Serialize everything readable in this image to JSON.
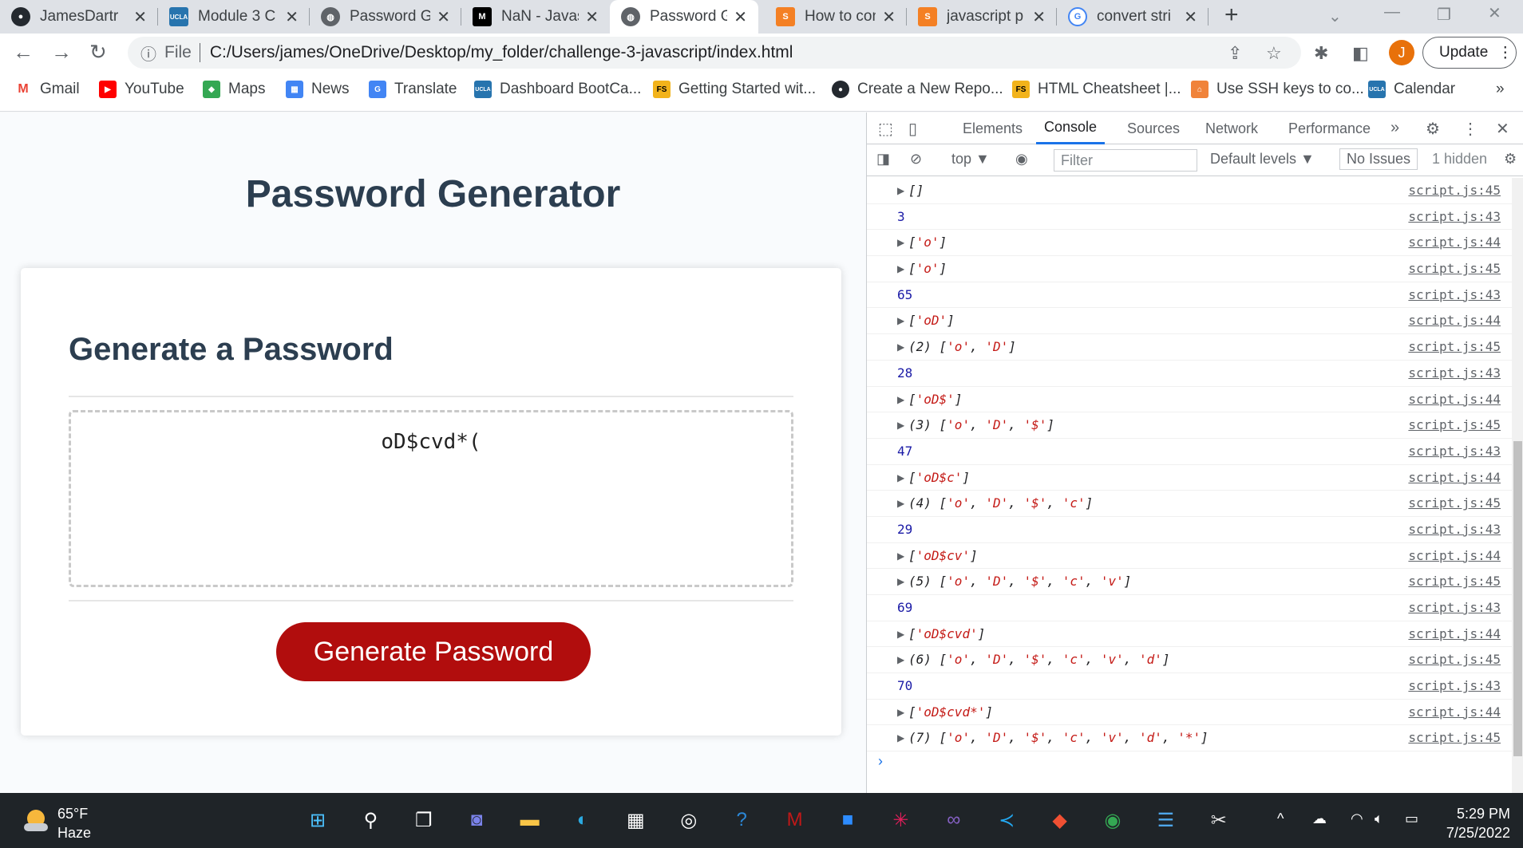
{
  "tabs": [
    {
      "title": "JamesDartr",
      "icon": "github-icon",
      "color": "#24292f"
    },
    {
      "title": "Module 3 C",
      "icon": "ucla-icon",
      "color": "#2774ae"
    },
    {
      "title": "Password G",
      "icon": "globe-icon",
      "color": "#5f6368"
    },
    {
      "title": "NaN - Javas",
      "icon": "mdn-icon",
      "color": "#000000"
    },
    {
      "title": "Password G",
      "icon": "globe-icon",
      "color": "#5f6368"
    },
    {
      "title": "How to con",
      "icon": "stackoverflow-icon",
      "color": "#f48024"
    },
    {
      "title": "javascript p",
      "icon": "stackoverflow-icon",
      "color": "#f48024"
    },
    {
      "title": "convert stri",
      "icon": "google-icon",
      "color": "#4285f4"
    }
  ],
  "address": {
    "scheme": "File",
    "url": "C:/Users/james/OneDrive/Desktop/my_folder/challenge-3-javascript/index.html"
  },
  "profile_initial": "J",
  "update_label": "Update",
  "bookmarks": [
    {
      "label": "Gmail",
      "icon": "gmail-icon"
    },
    {
      "label": "YouTube",
      "icon": "youtube-icon"
    },
    {
      "label": "Maps",
      "icon": "maps-icon"
    },
    {
      "label": "News",
      "icon": "news-icon"
    },
    {
      "label": "Translate",
      "icon": "translate-icon"
    },
    {
      "label": "Dashboard BootCa...",
      "icon": "ucla-icon"
    },
    {
      "label": "Getting Started wit...",
      "icon": "fs-icon"
    },
    {
      "label": "Create a New Repo...",
      "icon": "github-icon"
    },
    {
      "label": "HTML Cheatsheet |...",
      "icon": "fs-icon"
    },
    {
      "label": "Use SSH keys to co...",
      "icon": "ssh-icon"
    },
    {
      "label": "Calendar",
      "icon": "ucla-icon"
    }
  ],
  "page": {
    "title": "Password Generator",
    "card_title": "Generate a Password",
    "password": "oD$cvd*(",
    "button": "Generate Password"
  },
  "devtools": {
    "tabs": [
      "Elements",
      "Console",
      "Sources",
      "Network",
      "Performance"
    ],
    "context": "top ▼",
    "filter_placeholder": "Filter",
    "levels": "Default levels ▼",
    "issues": "No Issues",
    "hidden": "1 hidden",
    "logs": [
      {
        "kind": "arr",
        "text": "[]",
        "src": "script.js:45"
      },
      {
        "kind": "num",
        "text": "3",
        "src": "script.js:43"
      },
      {
        "kind": "arr",
        "text": "['o']",
        "src": "script.js:44"
      },
      {
        "kind": "arr",
        "text": "['o']",
        "src": "script.js:45"
      },
      {
        "kind": "num",
        "text": "65",
        "src": "script.js:43"
      },
      {
        "kind": "arr",
        "text": "['oD']",
        "src": "script.js:44"
      },
      {
        "kind": "arr",
        "text": "(2) ['o', 'D']",
        "src": "script.js:45"
      },
      {
        "kind": "num",
        "text": "28",
        "src": "script.js:43"
      },
      {
        "kind": "arr",
        "text": "['oD$']",
        "src": "script.js:44"
      },
      {
        "kind": "arr",
        "text": "(3) ['o', 'D', '$']",
        "src": "script.js:45"
      },
      {
        "kind": "num",
        "text": "47",
        "src": "script.js:43"
      },
      {
        "kind": "arr",
        "text": "['oD$c']",
        "src": "script.js:44"
      },
      {
        "kind": "arr",
        "text": "(4) ['o', 'D', '$', 'c']",
        "src": "script.js:45"
      },
      {
        "kind": "num",
        "text": "29",
        "src": "script.js:43"
      },
      {
        "kind": "arr",
        "text": "['oD$cv']",
        "src": "script.js:44"
      },
      {
        "kind": "arr",
        "text": "(5) ['o', 'D', '$', 'c', 'v']",
        "src": "script.js:45"
      },
      {
        "kind": "num",
        "text": "69",
        "src": "script.js:43"
      },
      {
        "kind": "arr",
        "text": "['oD$cvd']",
        "src": "script.js:44"
      },
      {
        "kind": "arr",
        "text": "(6) ['o', 'D', '$', 'c', 'v', 'd']",
        "src": "script.js:45"
      },
      {
        "kind": "num",
        "text": "70",
        "src": "script.js:43"
      },
      {
        "kind": "arr",
        "text": "['oD$cvd*']",
        "src": "script.js:44"
      },
      {
        "kind": "arr",
        "text": "(7) ['o', 'D', '$', 'c', 'v', 'd', '*']",
        "src": "script.js:45"
      }
    ]
  },
  "taskbar": {
    "weather_temp": "65°F",
    "weather_desc": "Haze",
    "time": "5:29 PM",
    "date": "7/25/2022",
    "apps": [
      "windows-start-icon",
      "search-icon",
      "task-view-icon",
      "chat-icon",
      "file-explorer-icon",
      "edge-icon",
      "store-icon",
      "github-desktop-icon",
      "help-icon",
      "mcafee-icon",
      "zoom-icon",
      "slack-icon",
      "visual-studio-icon",
      "vscode-icon",
      "git-icon",
      "chrome-icon",
      "notepad-icon",
      "snipping-tool-icon"
    ]
  }
}
